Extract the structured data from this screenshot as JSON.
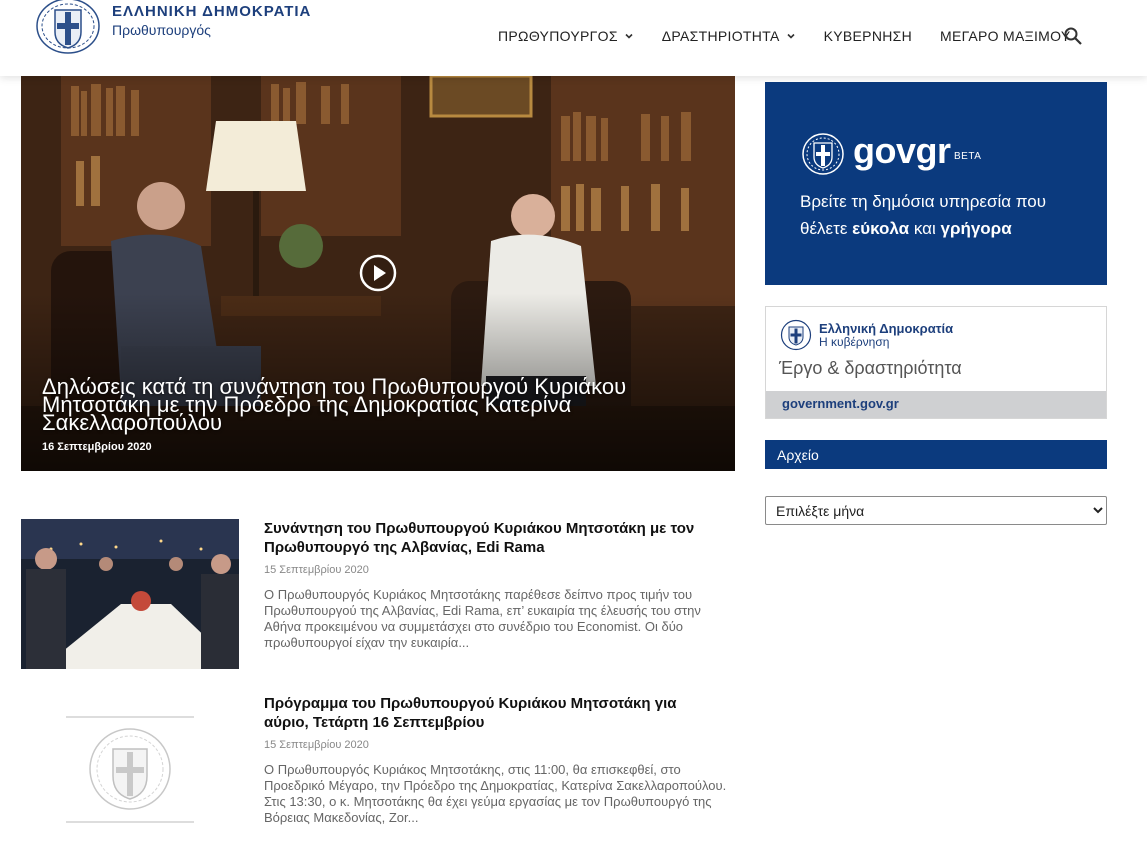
{
  "header": {
    "brand_title": "ΕΛΛΗΝΙΚΗ ΔΗΜΟΚΡΑΤΙΑ",
    "brand_subtitle": "Πρωθυπουργός",
    "nav": [
      {
        "label": "ΠΡΩΘΥΠΟΥΡΓΟΣ",
        "has_dropdown": true
      },
      {
        "label": "ΔΡΑΣΤΗΡΙΟΤΗΤΑ",
        "has_dropdown": true
      },
      {
        "label": "ΚΥΒΕΡΝΗΣΗ",
        "has_dropdown": false
      },
      {
        "label": "ΜΕΓΑΡΟ ΜΑΞΙΜΟΥ",
        "has_dropdown": false
      }
    ],
    "search_icon": "search-icon"
  },
  "hero": {
    "title": "Δηλώσεις κατά τη συνάντηση του Πρωθυπουργού Κυριάκου Μητσοτάκη με την Πρόεδρο της Δημοκρατίας Κατερίνα Σακελλαροπούλου",
    "date": "16 Σεπτεμβρίου 2020",
    "icon": "play-icon"
  },
  "articles": [
    {
      "title": "Συνάντηση του Πρωθυπουργού Κυριάκου Μητσοτάκη με τον Πρωθυπουργό της Αλβανίας, Edi Rama",
      "date": "15 Σεπτεμβρίου 2020",
      "excerpt": "Ο Πρωθυπουργός Κυριάκος Μητσοτάκης παρέθεσε δείπνο προς τιμήν του Πρωθυπουργού της Αλβανίας, Edi Rama, επ’ ευκαιρία της έλευσής του στην Αθήνα προκειμένου να συμμετάσχει στο συνέδριο του Economist. Οι δύο πρωθυπουργοί είχαν την ευκαιρία..."
    },
    {
      "title": "Πρόγραμμα του Πρωθυπουργού Κυριάκου Μητσοτάκη για αύριο, Τετάρτη 16 Σεπτεμβρίου",
      "date": "15 Σεπτεμβρίου 2020",
      "excerpt": "Ο Πρωθυπουργός Κυριάκος Μητσοτάκης, στις 11:00, θα επισκεφθεί, στο Προεδρικό Μέγαρο, την Πρόεδρο της Δημοκρατίας, Κατερίνα Σακελλαροπούλου. Στις 13:30, ο κ. Μητσοτάκης θα έχει γεύμα εργασίας με τον Πρωθυπουργό της Βόρειας Μακεδονίας, Zor..."
    }
  ],
  "sidebar": {
    "govgr": {
      "logo_text": "govgr",
      "beta_label": "BETA",
      "line1": "Βρείτε τη δημόσια υπηρεσία που",
      "line2_prefix": "θέλετε",
      "line2_bold1": "εύκολα",
      "line2_mid": "και",
      "line2_bold2": "γρήγορα",
      "brand_color": "#0b3a7e"
    },
    "government_box": {
      "title": "Ελληνική Δημοκρατία",
      "subtitle": "Η κυβέρνηση",
      "tagline": "Έργο & δραστηριότητα",
      "link": "government.gov.gr"
    },
    "archive": {
      "heading": "Αρχείο",
      "select_value": "Επιλέξτε μήνα"
    }
  },
  "colors": {
    "accent": "#0b3a7e",
    "brand_text": "#1d3f7c"
  }
}
